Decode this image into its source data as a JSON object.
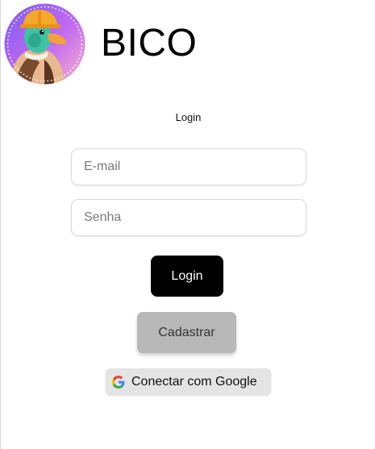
{
  "header": {
    "brand": "BICO",
    "logo_icon": "duck-hardhat-logo-icon"
  },
  "form": {
    "title": "Login",
    "email_placeholder": "E-mail",
    "password_placeholder": "Senha",
    "login_label": "Login",
    "register_label": "Cadastrar",
    "google_label": "Conectar com Google",
    "google_icon": "google-g-icon"
  },
  "colors": {
    "primary_button": "#000000",
    "secondary_button": "#b9b8b8",
    "google_button": "#e4e4e4",
    "logo_gradient_start": "#a54cf0",
    "logo_gradient_end": "#f6a9c8"
  }
}
